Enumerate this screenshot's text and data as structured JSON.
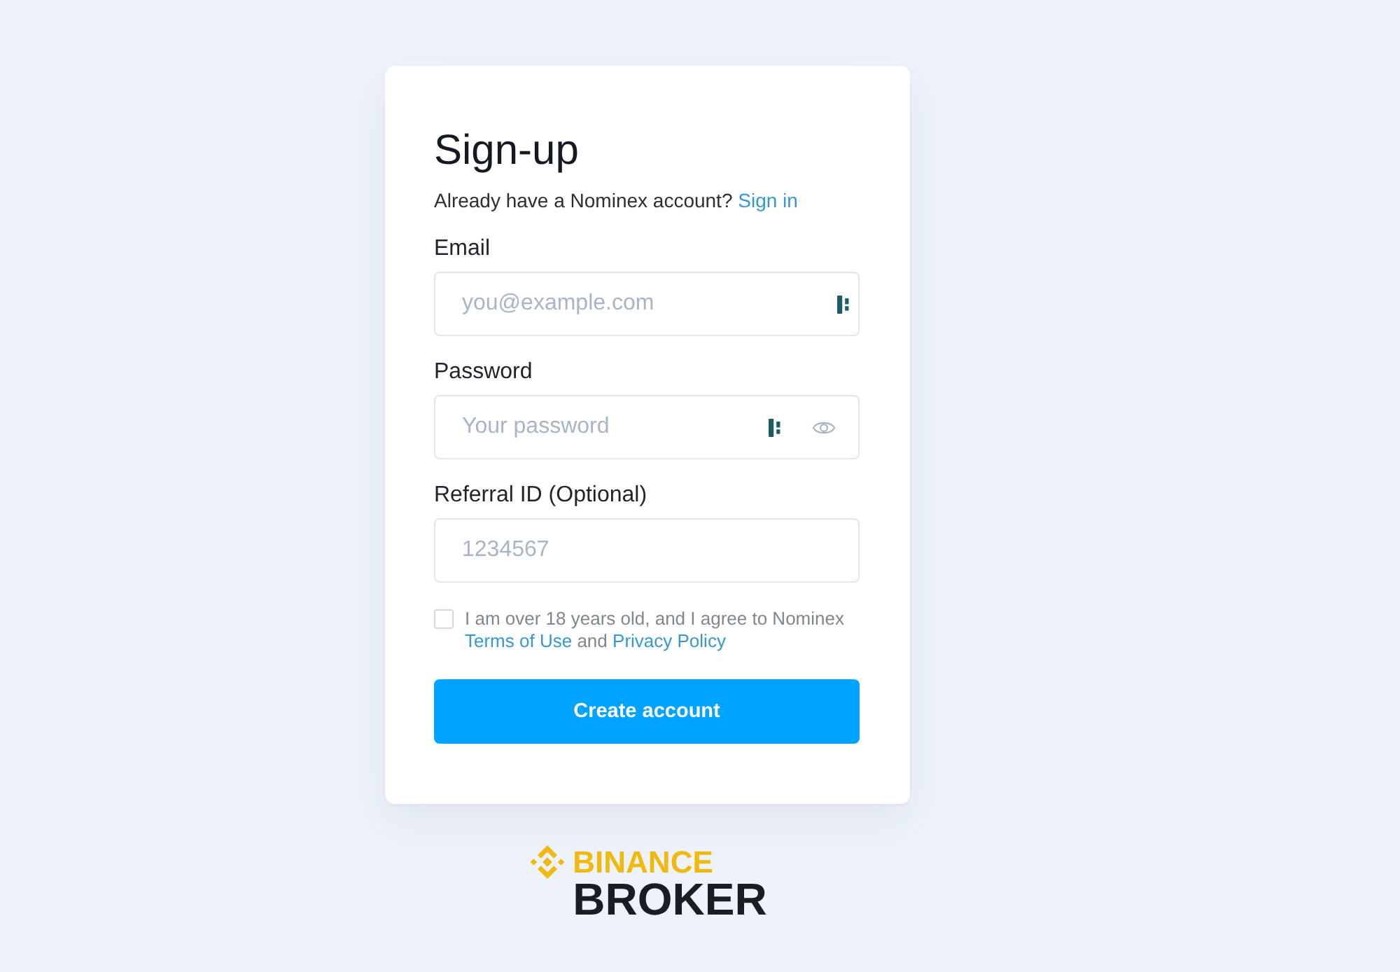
{
  "card": {
    "title": "Sign-up",
    "prompt": {
      "text": "Already have a Nominex account?",
      "link": "Sign in"
    },
    "fields": [
      {
        "kind": "email",
        "label": "Email",
        "placeholder": "you@example.com"
      },
      {
        "kind": "password",
        "label": "Password",
        "placeholder": "Your password"
      },
      {
        "kind": "text",
        "label": "Referral ID (Optional)",
        "placeholder": "1234567"
      }
    ],
    "agreement": {
      "checked": false,
      "parts": [
        {
          "kind": "text",
          "text": "I am over 18 years old, and I agree to Nominex"
        },
        {
          "kind": "link",
          "text": "Terms of Use"
        },
        {
          "kind": "text",
          "text": "and"
        },
        {
          "kind": "link",
          "text": "Privacy Policy"
        }
      ]
    },
    "submit_button": "Create account"
  },
  "logo": {
    "top": "BINANCE",
    "bottom": "BROKER"
  }
}
